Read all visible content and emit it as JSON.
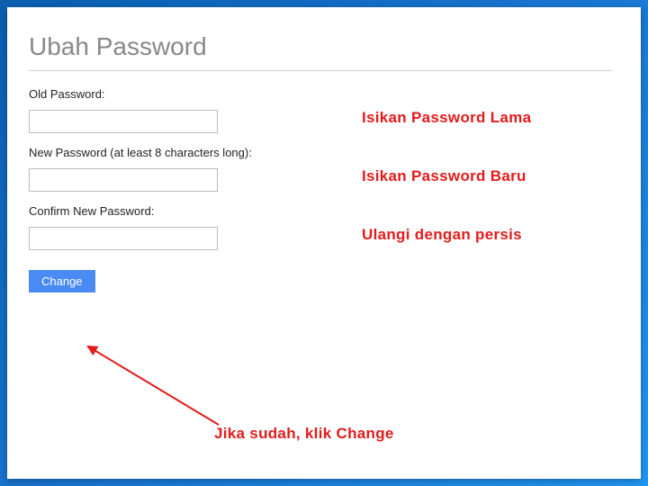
{
  "page": {
    "title": "Ubah Password"
  },
  "form": {
    "old_password": {
      "label": "Old Password:",
      "value": ""
    },
    "new_password": {
      "label": "New Password (at least 8 characters long):",
      "value": ""
    },
    "confirm_password": {
      "label": "Confirm New Password:",
      "value": ""
    },
    "submit_label": "Change"
  },
  "annotations": {
    "old": "Isikan Password Lama",
    "new": "Isikan Password Baru",
    "confirm": "Ulangi dengan persis",
    "submit": "Jika sudah, klik Change"
  },
  "colors": {
    "annotation_red": "#e31b1b",
    "button_blue": "#4a8af4",
    "title_gray": "#888888"
  }
}
